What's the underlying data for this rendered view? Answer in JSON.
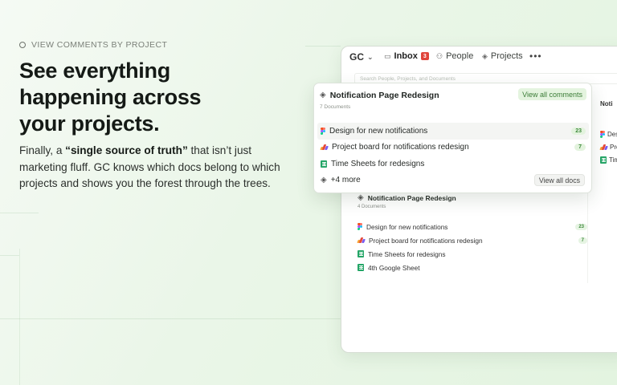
{
  "hero": {
    "eyebrow": "VIEW COMMENTS BY PROJECT",
    "headline_lines": [
      "See everything",
      "happening across",
      "your projects."
    ],
    "body_before": "Finally, a ",
    "body_bold": "“single source of truth”",
    "body_after": " that isn’t just marketing fluff. GC knows which docs belong to which projects and shows you the forest through the trees."
  },
  "app": {
    "logo": "GC",
    "nav": {
      "inbox_label": "Inbox",
      "inbox_badge": "3",
      "people_label": "People",
      "projects_label": "Projects",
      "more": "•••"
    },
    "search_placeholder": "Search People, Projects, and Documents",
    "background_project": {
      "title": "Notification Page Redesign",
      "count": "4 Documents",
      "items": [
        {
          "label": "Design for new notifications",
          "icon": "figma-icon",
          "count": "23"
        },
        {
          "label": "Project board for notifications redesign",
          "icon": "board-icon",
          "count": "7"
        },
        {
          "label": "Time Sheets for redesigns",
          "icon": "sheets-icon",
          "count": ""
        },
        {
          "label": "4th Google Sheet",
          "icon": "sheets-icon",
          "count": ""
        }
      ]
    },
    "side_column": {
      "title": "Noti",
      "items": [
        "Des",
        "Proj",
        "Tim"
      ]
    },
    "popup": {
      "title": "Notification Page Redesign",
      "count": "7 Documents",
      "view_all_comments": "View all comments",
      "items": [
        {
          "label": "Design for new notifications",
          "icon": "figma-icon",
          "count": "23",
          "highlighted": true
        },
        {
          "label": "Project board for notifications redesign",
          "icon": "board-icon",
          "count": "7",
          "highlighted": false
        },
        {
          "label": "Time Sheets for redesigns",
          "icon": "sheets-icon",
          "count": "",
          "highlighted": false
        }
      ],
      "more_label": "+4 more",
      "view_all_docs": "View all docs"
    }
  },
  "colors": {
    "accent_green": "#3b7c37",
    "badge_red": "#e0453b",
    "background": "#eaf6e8"
  }
}
